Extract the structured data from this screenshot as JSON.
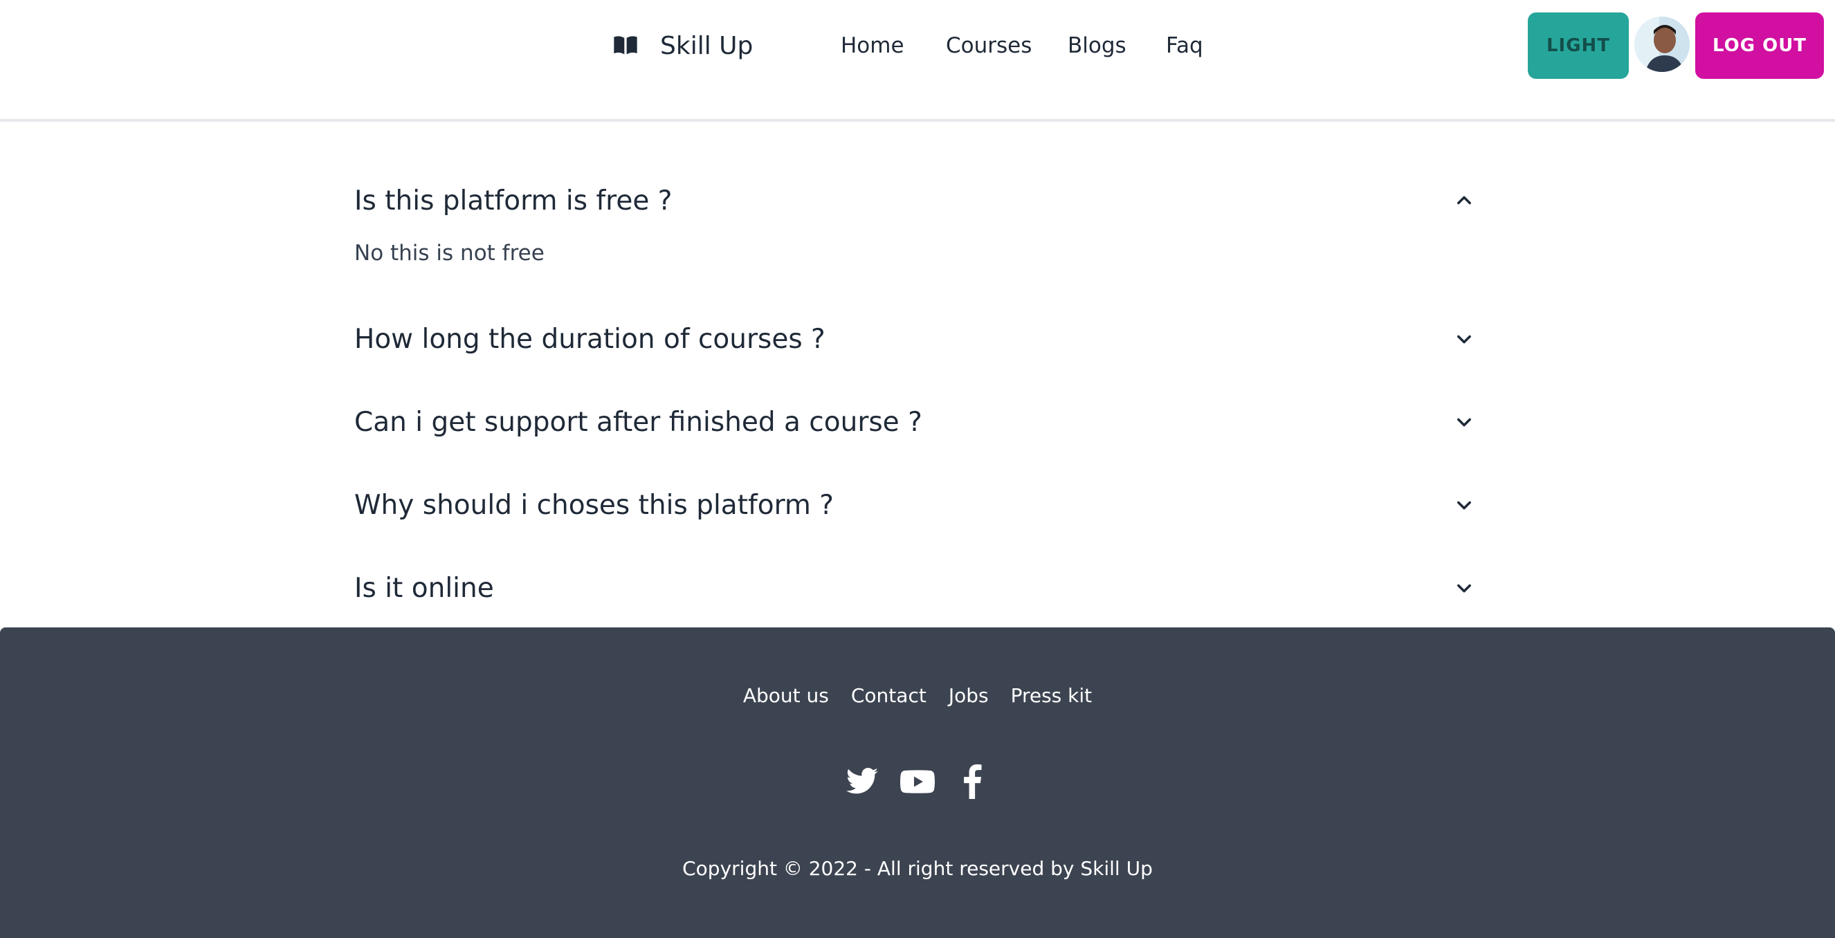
{
  "header": {
    "brand": "Skill Up",
    "nav": [
      "Home",
      "Courses",
      "Blogs",
      "Faq"
    ],
    "theme_button": "LIGHT",
    "logout_button": "LOG OUT"
  },
  "faq": [
    {
      "question": "Is this platform is free ?",
      "answer": "No this is not free",
      "expanded": true
    },
    {
      "question": "How long the duration of courses ?",
      "expanded": false
    },
    {
      "question": "Can i get support after finished a course ?",
      "expanded": false
    },
    {
      "question": "Why should i choses this platform ?",
      "expanded": false
    },
    {
      "question": "Is it online",
      "expanded": false
    }
  ],
  "footer": {
    "links": [
      "About us",
      "Contact",
      "Jobs",
      "Press kit"
    ],
    "social_icons": [
      "twitter-icon",
      "youtube-icon",
      "facebook-icon"
    ],
    "copyright": "Copyright © 2022 - All right reserved by Skill Up"
  },
  "colors": {
    "light_button": "#26a69a",
    "logout_button": "#d10fa1",
    "footer_bg": "#3d4451",
    "text": "#1f2937"
  }
}
